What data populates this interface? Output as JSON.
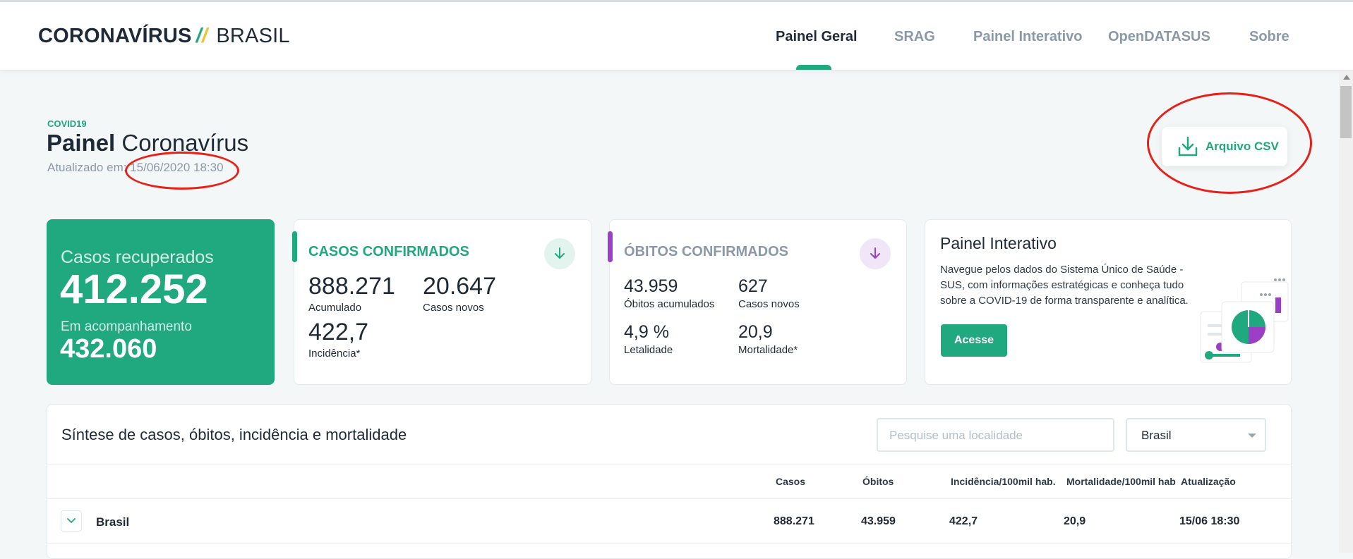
{
  "header": {
    "logo_strong": "CORONAVÍRUS",
    "logo_light": "BRASIL",
    "nav": [
      "Painel Geral",
      "SRAG",
      "Painel Interativo",
      "OpenDATASUS",
      "Sobre"
    ],
    "active_nav": "Painel Geral"
  },
  "page": {
    "kicker": "COVID19",
    "title_bold": "Painel",
    "title_rest": "Coronavírus",
    "updated_label": "Atualizado em:",
    "updated_value": "15/06/2020 18:30",
    "csv_button": "Arquivo CSV"
  },
  "recovered": {
    "label": "Casos recuperados",
    "value": "412.252",
    "following_label": "Em acompanhamento",
    "following_value": "432.060"
  },
  "cases": {
    "title": "CASOS CONFIRMADOS",
    "accumulated": "888.271",
    "accumulated_label": "Acumulado",
    "new": "20.647",
    "new_label": "Casos novos",
    "incidence": "422,7",
    "incidence_label": "Incidência*"
  },
  "deaths": {
    "title": "ÓBITOS CONFIRMADOS",
    "accumulated": "43.959",
    "accumulated_label": "Óbitos acumulados",
    "new": "627",
    "new_label": "Casos novos",
    "lethality": "4,9 %",
    "lethality_label": "Letalidade",
    "mortality": "20,9",
    "mortality_label": "Mortalidade*"
  },
  "interactive": {
    "title": "Painel Interativo",
    "description": "Navegue pelos dados do Sistema Único de Saúde - SUS, com informações estratégicas e conheça tudo sobre a COVID-19 de forma transparente e analítica.",
    "button": "Acesse"
  },
  "synthesis": {
    "title": "Síntese de casos, óbitos, incidência e mortalidade",
    "search_placeholder": "Pesquise uma localidade",
    "select_value": "Brasil",
    "columns": [
      "Casos",
      "Óbitos",
      "Incidência/100mil hab.",
      "Mortalidade/100mil hab",
      "Atualização"
    ],
    "rows": [
      {
        "name": "Brasil",
        "values": [
          "888.271",
          "43.959",
          "422,7",
          "20,9",
          "15/06 18:30"
        ]
      }
    ]
  },
  "colors": {
    "accent": "#20a87e",
    "purple": "#9b3fc7",
    "annotation": "#e8201a"
  }
}
